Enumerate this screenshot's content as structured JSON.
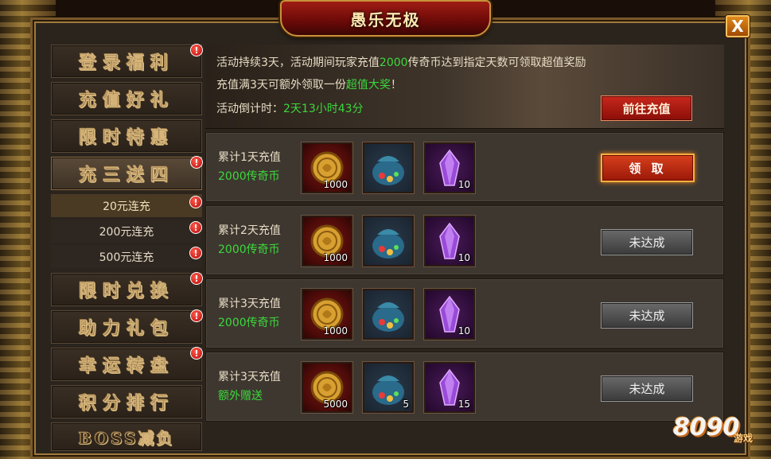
{
  "window": {
    "title": "愚乐无极",
    "close_label": "X"
  },
  "sidebar": {
    "items": [
      {
        "label": "登录福利",
        "alert": "!"
      },
      {
        "label": "充值好礼"
      },
      {
        "label": "限时特惠"
      },
      {
        "label": "充三送四",
        "alert": "!",
        "active": true
      },
      {
        "label": "20元连充",
        "alert": "!"
      },
      {
        "label": "200元连充",
        "alert": "!"
      },
      {
        "label": "500元连充",
        "alert": "!"
      },
      {
        "label": "限时兑换",
        "alert": "!"
      },
      {
        "label": "助力礼包",
        "alert": "!"
      },
      {
        "label": "幸运转盘",
        "alert": "!"
      },
      {
        "label": "积分排行"
      },
      {
        "label": "BOSS减负"
      }
    ]
  },
  "banner": {
    "line1_a": "活动持续3天，活动期间玩家充值",
    "line1_amount": "2000",
    "line1_b": "传奇币达到指定天数可领取超值奖励",
    "line2_a": "充值满3天可额外领取一份",
    "line2_highlight": "超值大奖",
    "line2_b": "！",
    "countdown_label": "活动倒计时：",
    "countdown_value": "2天13小时43分",
    "goto_button": "前往充值"
  },
  "rows": [
    {
      "label": "累计1天充值",
      "sub": "2000传奇币",
      "items": [
        {
          "icon": "gold-coin-icon",
          "count": "1000"
        },
        {
          "icon": "treasure-bag-icon",
          "count": ""
        },
        {
          "icon": "purple-crystal-icon",
          "count": "10"
        }
      ],
      "action": "领 取",
      "action_type": "claim"
    },
    {
      "label": "累计2天充值",
      "sub": "2000传奇币",
      "items": [
        {
          "icon": "gold-coin-icon",
          "count": "1000"
        },
        {
          "icon": "treasure-bag-icon",
          "count": ""
        },
        {
          "icon": "purple-crystal-icon",
          "count": "10"
        }
      ],
      "action": "未达成",
      "action_type": "pending"
    },
    {
      "label": "累计3天充值",
      "sub": "2000传奇币",
      "items": [
        {
          "icon": "gold-coin-icon",
          "count": "1000"
        },
        {
          "icon": "treasure-bag-icon",
          "count": ""
        },
        {
          "icon": "purple-crystal-icon",
          "count": "10"
        }
      ],
      "action": "未达成",
      "action_type": "pending"
    },
    {
      "label": "累计3天充值",
      "sub": "额外赠送",
      "items": [
        {
          "icon": "gold-coin-icon",
          "count": "5000"
        },
        {
          "icon": "treasure-bag-icon",
          "count": "5"
        },
        {
          "icon": "purple-crystal-icon",
          "count": "15"
        }
      ],
      "action": "未达成",
      "action_type": "pending"
    }
  ],
  "watermark": {
    "brand": "8090",
    "tag": "游戏"
  },
  "colors": {
    "accent_green": "#3cd83c",
    "title_red": "#a01c14",
    "gold": "#c8923a"
  }
}
